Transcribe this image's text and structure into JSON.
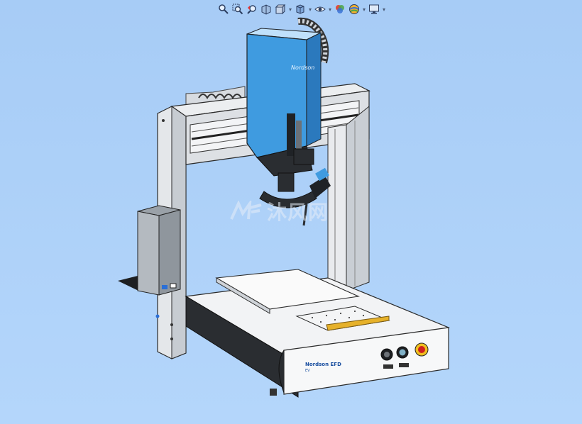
{
  "toolbar": {
    "buttons": [
      {
        "name": "zoom-to-fit-icon"
      },
      {
        "name": "zoom-to-area-icon"
      },
      {
        "name": "previous-view-icon"
      },
      {
        "name": "section-view-icon"
      },
      {
        "name": "view-orientation-icon"
      },
      {
        "name": "display-style-icon"
      },
      {
        "name": "hide-show-items-icon"
      },
      {
        "name": "edit-appearance-icon"
      },
      {
        "name": "apply-scene-icon"
      },
      {
        "name": "view-settings-icon"
      }
    ]
  },
  "model": {
    "head_logo": "Nordson",
    "base_logo": "Nordson EFD",
    "base_model": "EV",
    "panel_labels": [
      "AUTO/MANUAL",
      "START",
      "EMERGENCY STOP"
    ]
  },
  "watermark": {
    "text": "沐风网"
  },
  "colors": {
    "background": "#a9cef7",
    "head_blue": "#3f9be0",
    "frame_gray": "#d9dde2",
    "base_white": "#f5f6f7",
    "dark": "#1f2226"
  }
}
